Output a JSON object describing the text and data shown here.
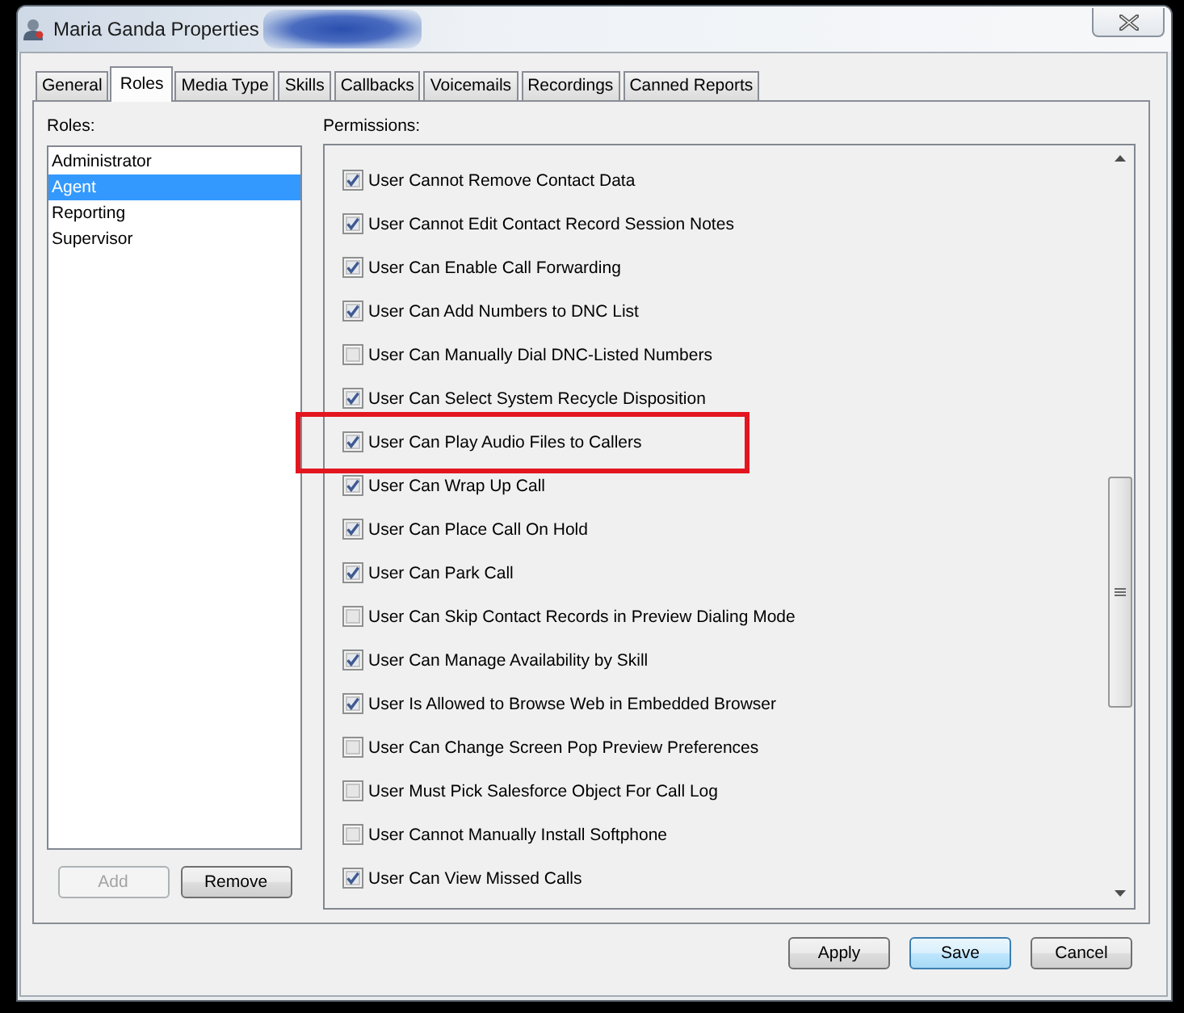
{
  "window": {
    "title": "Maria Ganda Properties"
  },
  "tabs": [
    {
      "label": "General",
      "selected": false
    },
    {
      "label": "Roles",
      "selected": true
    },
    {
      "label": "Media Type",
      "selected": false
    },
    {
      "label": "Skills",
      "selected": false
    },
    {
      "label": "Callbacks",
      "selected": false
    },
    {
      "label": "Voicemails",
      "selected": false
    },
    {
      "label": "Recordings",
      "selected": false
    },
    {
      "label": "Canned Reports",
      "selected": false
    }
  ],
  "roles": {
    "label": "Roles:",
    "items": [
      {
        "label": "Administrator",
        "selected": false
      },
      {
        "label": "Agent",
        "selected": true
      },
      {
        "label": "Reporting",
        "selected": false
      },
      {
        "label": "Supervisor",
        "selected": false
      }
    ],
    "buttons": [
      {
        "label": "Add",
        "disabled": true
      },
      {
        "label": "Remove",
        "disabled": false
      }
    ]
  },
  "permissions": {
    "label": "Permissions:",
    "items": [
      {
        "label": "User Cannot Remove Contact Data",
        "checked": true,
        "highlighted": false
      },
      {
        "label": "User Cannot Edit Contact Record Session Notes",
        "checked": true,
        "highlighted": false
      },
      {
        "label": "User Can Enable Call Forwarding",
        "checked": true,
        "highlighted": false
      },
      {
        "label": "User Can Add Numbers to DNC List",
        "checked": true,
        "highlighted": false
      },
      {
        "label": "User Can Manually Dial DNC-Listed Numbers",
        "checked": false,
        "highlighted": false
      },
      {
        "label": "User Can Select System Recycle Disposition",
        "checked": true,
        "highlighted": false
      },
      {
        "label": "User Can Play Audio Files to Callers",
        "checked": true,
        "highlighted": true
      },
      {
        "label": "User Can Wrap Up Call",
        "checked": true,
        "highlighted": false
      },
      {
        "label": "User Can Place Call On Hold",
        "checked": true,
        "highlighted": false
      },
      {
        "label": "User Can Park Call",
        "checked": true,
        "highlighted": false
      },
      {
        "label": "User Can Skip Contact Records in Preview Dialing Mode",
        "checked": false,
        "highlighted": false
      },
      {
        "label": "User Can Manage Availability by Skill",
        "checked": true,
        "highlighted": false
      },
      {
        "label": "User Is Allowed to Browse Web in Embedded Browser",
        "checked": true,
        "highlighted": false
      },
      {
        "label": "User Can Change Screen Pop Preview Preferences",
        "checked": false,
        "highlighted": false
      },
      {
        "label": "User Must Pick Salesforce Object For Call Log",
        "checked": false,
        "highlighted": false
      },
      {
        "label": "User Cannot Manually Install Softphone",
        "checked": false,
        "highlighted": false
      },
      {
        "label": "User Can View Missed Calls",
        "checked": true,
        "highlighted": false
      }
    ]
  },
  "buttons": [
    {
      "label": "Apply",
      "default": false
    },
    {
      "label": "Save",
      "default": true
    },
    {
      "label": "Cancel",
      "default": false
    }
  ]
}
